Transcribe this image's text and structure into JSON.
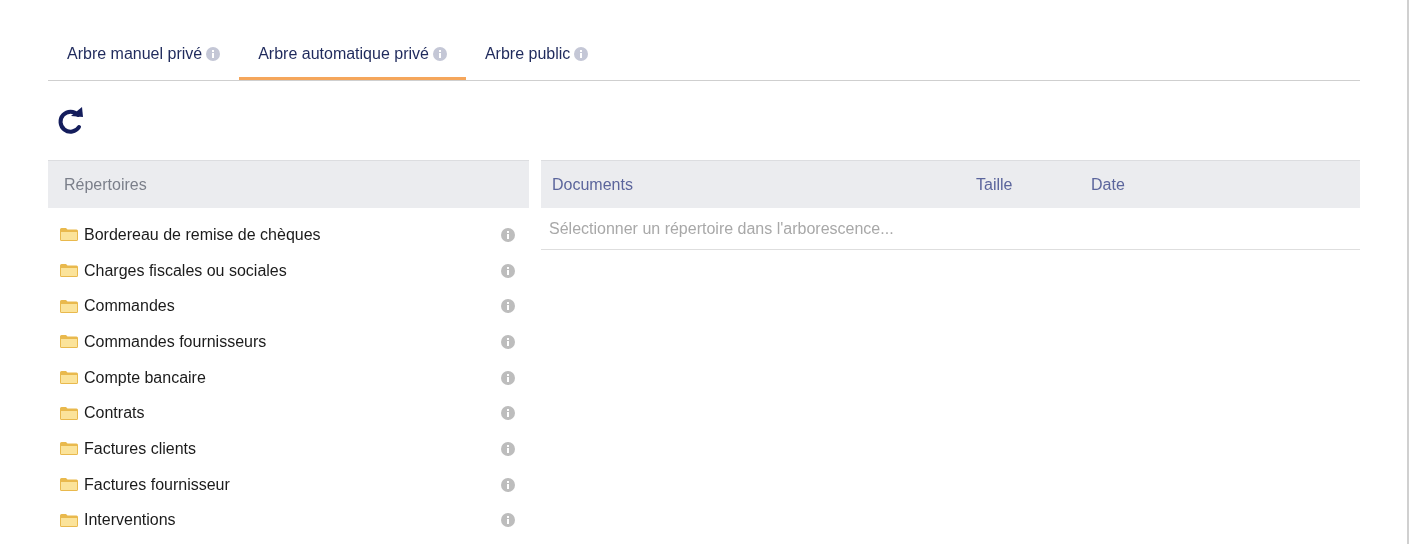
{
  "tabs": [
    {
      "label": "Arbre manuel privé",
      "selected": false
    },
    {
      "label": "Arbre automatique privé",
      "selected": true
    },
    {
      "label": "Arbre public",
      "selected": false
    }
  ],
  "directories": {
    "header": "Répertoires",
    "items": [
      {
        "name": "Bordereau de remise de chèques"
      },
      {
        "name": "Charges fiscales ou sociales"
      },
      {
        "name": "Commandes"
      },
      {
        "name": "Commandes fournisseurs"
      },
      {
        "name": "Compte bancaire"
      },
      {
        "name": "Contrats"
      },
      {
        "name": "Factures clients"
      },
      {
        "name": "Factures fournisseur"
      },
      {
        "name": "Interventions"
      }
    ]
  },
  "documents": {
    "columns": [
      "Documents",
      "Taille",
      "Date"
    ],
    "empty_message": "Sélectionner un répertoire dans l'arborescence..."
  }
}
